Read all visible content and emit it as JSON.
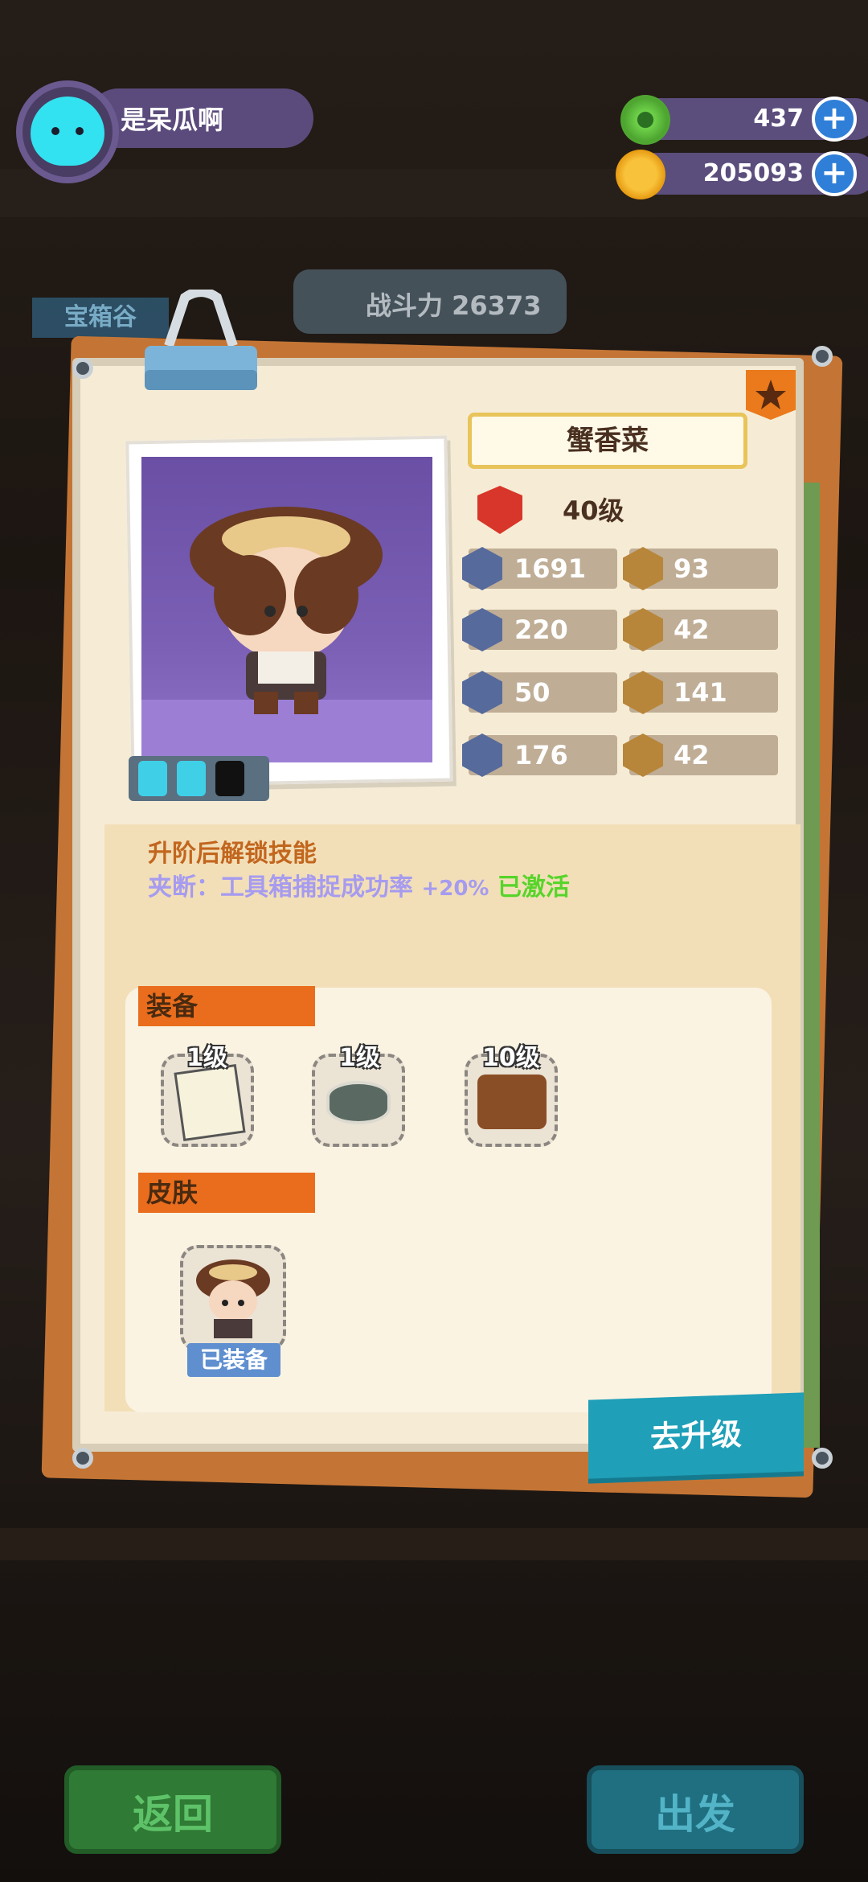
{
  "header": {
    "username": "是呆瓜啊",
    "avatar_icon": "cat-face-icon",
    "currency_gem": {
      "icon": "green-donut-icon",
      "value": "437"
    },
    "currency_coin": {
      "icon": "gold-planet-coin-icon",
      "value": "205093"
    },
    "plus_symbol": "+"
  },
  "background": {
    "location_label": "宝箱谷",
    "power_label": "战斗力 26373"
  },
  "character": {
    "name": "蟹香菜",
    "level": "40级",
    "stats_left": [
      {
        "icon": "heart-shield-icon",
        "value": "1691"
      },
      {
        "icon": "rocket-icon",
        "value": "220"
      },
      {
        "icon": "shield-icon",
        "value": "50"
      },
      {
        "icon": "anchor-icon",
        "value": "176"
      }
    ],
    "stats_right": [
      {
        "icon": "bread-icon",
        "value": "93"
      },
      {
        "icon": "smile-icon",
        "value": "42"
      },
      {
        "icon": "muscle-icon",
        "value": "141"
      },
      {
        "icon": "brain-icon",
        "value": "42"
      }
    ]
  },
  "skill": {
    "title": "升阶后解锁技能",
    "desc_prefix": "夹断：工具箱捕捉成功率",
    "desc_pct": "+20%",
    "status": "已激活"
  },
  "equipment": {
    "label": "装备",
    "items": [
      {
        "icon": "seed-packet-icon",
        "level": "1级"
      },
      {
        "icon": "drum-icon",
        "level": "1级"
      },
      {
        "icon": "wallet-icon",
        "level": "10级"
      }
    ]
  },
  "skin": {
    "label": "皮肤",
    "equipped_label": "已装备"
  },
  "actions": {
    "upgrade": "去升级",
    "back": "返回",
    "depart": "出发"
  },
  "colors": {
    "accent_orange": "#e96d1d",
    "upgrade_teal": "#1f9fb8",
    "skill_purple": "#a69bef",
    "active_green": "#57d42a"
  }
}
